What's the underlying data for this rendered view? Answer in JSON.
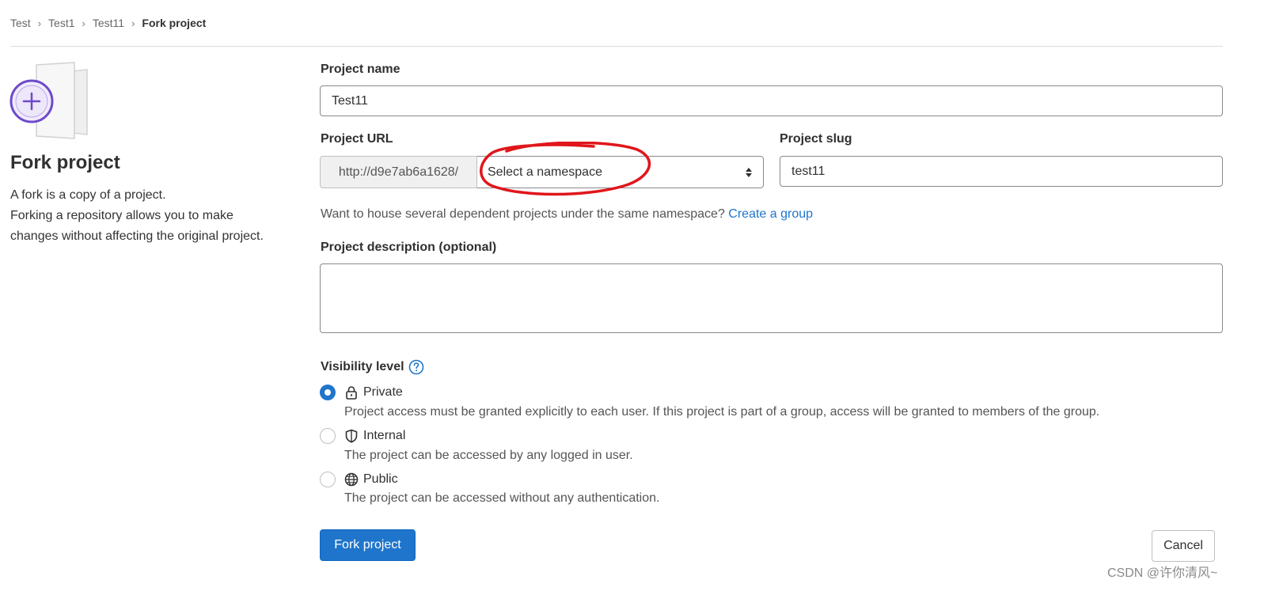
{
  "breadcrumb": {
    "items": [
      "Test",
      "Test1",
      "Test11"
    ],
    "current": "Fork project"
  },
  "left": {
    "title": "Fork project",
    "description": [
      "A fork is a copy of a project.",
      "Forking a repository allows you to make",
      "changes without affecting the original project."
    ]
  },
  "form": {
    "project_name": {
      "label": "Project name",
      "value": "Test11"
    },
    "project_url": {
      "label": "Project URL",
      "prefix": "http://d9e7ab6a1628/",
      "namespace_placeholder": "Select a namespace"
    },
    "project_slug": {
      "label": "Project slug",
      "value": "test11"
    },
    "helper": {
      "text": "Want to house several dependent projects under the same namespace?",
      "link": "Create a group"
    },
    "description": {
      "label": "Project description (optional)",
      "value": ""
    },
    "visibility": {
      "label": "Visibility level",
      "options": [
        {
          "name": "Private",
          "description": "Project access must be granted explicitly to each user. If this project is part of a group, access will be granted to members of the group.",
          "icon": "lock-icon",
          "checked": true
        },
        {
          "name": "Internal",
          "description": "The project can be accessed by any logged in user.",
          "icon": "shield-icon",
          "checked": false
        },
        {
          "name": "Public",
          "description": "The project can be accessed without any authentication.",
          "icon": "globe-icon",
          "checked": false
        }
      ]
    },
    "submit_label": "Fork project",
    "cancel_label": "Cancel"
  },
  "watermark": "CSDN @许你清风~",
  "colors": {
    "primary": "#1f75cb",
    "annotation": "#e0161b",
    "illustration_purple": "#6e49cb"
  }
}
